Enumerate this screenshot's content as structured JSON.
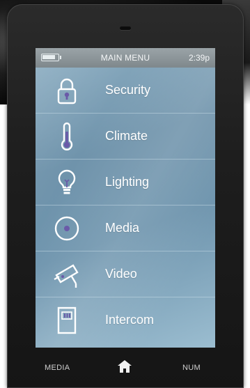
{
  "status_bar": {
    "title": "MAIN MENU",
    "time": "2:39p",
    "battery_level": 0.85
  },
  "menu": {
    "items": [
      {
        "label": "Security",
        "icon": "padlock-icon"
      },
      {
        "label": "Climate",
        "icon": "thermometer-icon"
      },
      {
        "label": "Lighting",
        "icon": "lightbulb-icon"
      },
      {
        "label": "Media",
        "icon": "media-disc-icon"
      },
      {
        "label": "Video",
        "icon": "camera-icon"
      },
      {
        "label": "Intercom",
        "icon": "intercom-panel-icon"
      }
    ]
  },
  "bottom_bar": {
    "left_label": "MEDIA",
    "center_icon": "home-icon",
    "right_label": "NUM"
  },
  "colors": {
    "accent_purple": "#6a5aa8",
    "icon_stroke": "#ffffff",
    "screen_blue": "#7a9db4"
  }
}
